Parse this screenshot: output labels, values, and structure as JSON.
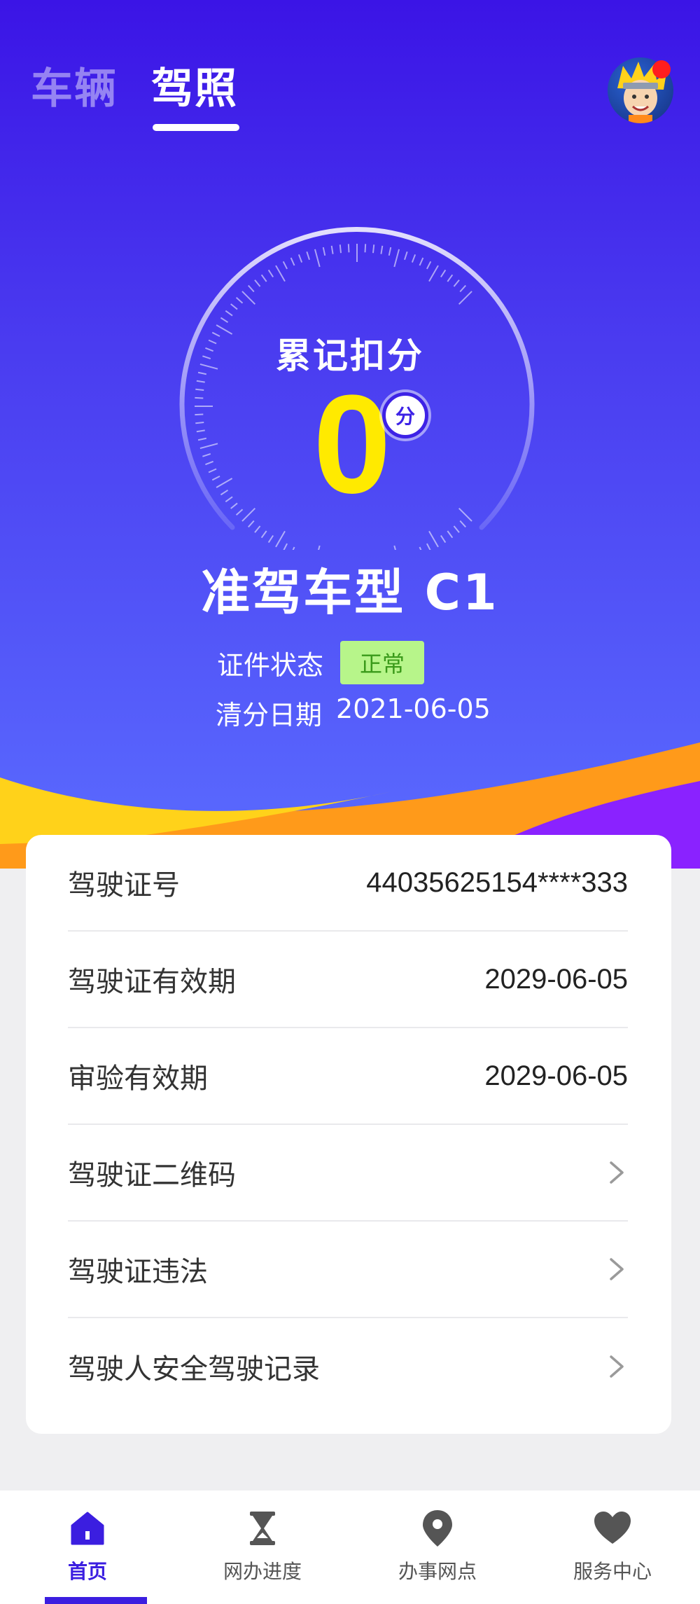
{
  "header": {
    "tabs": [
      {
        "label": "车辆",
        "active": false
      },
      {
        "label": "驾照",
        "active": true
      }
    ],
    "notification_dot_color": "#ff1e1e"
  },
  "score_panel": {
    "title": "累记扣分",
    "score": "0",
    "unit": "分",
    "license_type": "准驾车型 C1",
    "status_label": "证件状态",
    "status_value": "正常",
    "clear_date_label": "清分日期",
    "clear_date_value": "2021-06-05"
  },
  "details": [
    {
      "label": "驾驶证号",
      "value": "44035625154****333",
      "chevron": false
    },
    {
      "label": "驾驶证有效期",
      "value": "2029-06-05",
      "chevron": false
    },
    {
      "label": "审验有效期",
      "value": "2029-06-05",
      "chevron": false
    },
    {
      "label": "驾驶证二维码",
      "value": "",
      "chevron": true
    },
    {
      "label": "驾驶证违法",
      "value": "",
      "chevron": true
    },
    {
      "label": "驾驶人安全驾驶记录",
      "value": "",
      "chevron": true
    }
  ],
  "bottom_nav": [
    {
      "label": "首页",
      "icon": "home-icon",
      "active": true
    },
    {
      "label": "网办进度",
      "icon": "hourglass-icon",
      "active": false
    },
    {
      "label": "办事网点",
      "icon": "location-pin-icon",
      "active": false
    },
    {
      "label": "服务中心",
      "icon": "heart-icon",
      "active": false
    }
  ],
  "colors": {
    "brand": "#3b1ee0",
    "score": "#ffea00",
    "status_badge_bg": "#b7f58a",
    "wave_yellow": "#ffd21a",
    "wave_orange": "#ff9a1a",
    "wave_purple": "#8a22ff"
  }
}
